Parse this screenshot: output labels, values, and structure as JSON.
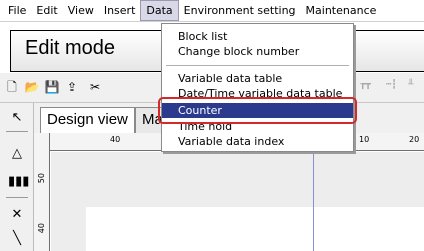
{
  "menu_bar": {
    "items": [
      "File",
      "Edit",
      "View",
      "Insert",
      "Data",
      "Environment setting",
      "Maintenance"
    ],
    "active": "Data"
  },
  "mode_header": {
    "title": "Edit mode"
  },
  "tabs": [
    {
      "label": "Design view"
    },
    {
      "label": "Ma"
    }
  ],
  "data_menu": {
    "items": [
      "Block list",
      "Change block number",
      "Variable data table",
      "Date/Time variable data table",
      "Counter",
      "Time hold",
      "Variable data index"
    ],
    "selected": "Counter",
    "highlight_color": "#d62828",
    "selection_color": "#2b3a8c"
  },
  "ruler": {
    "h_labels": [
      "40",
      "10",
      "20"
    ],
    "v_labels": [
      "50",
      "40"
    ]
  }
}
